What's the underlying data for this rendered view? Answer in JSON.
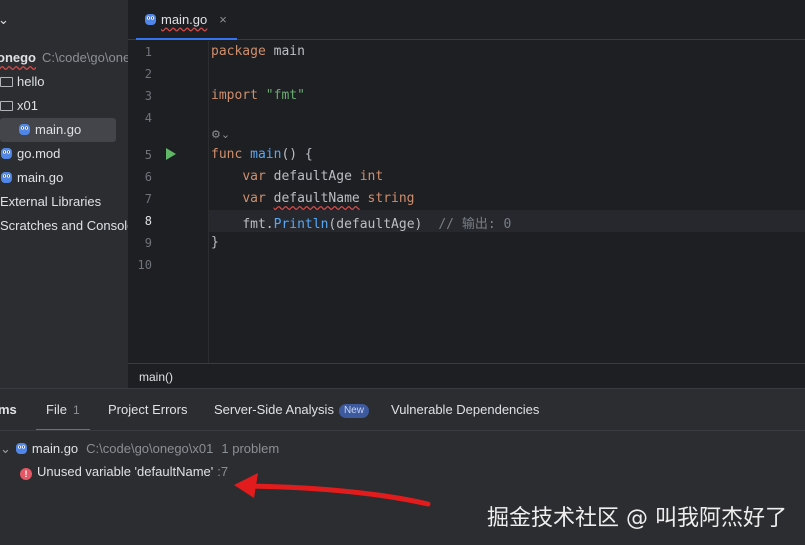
{
  "sidebar": {
    "header_chevron": "⌄",
    "root": {
      "name": "onego",
      "path": "C:\\code\\go\\onego"
    },
    "items": [
      {
        "label": "hello",
        "kind": "folder"
      },
      {
        "label": "x01",
        "kind": "folder"
      },
      {
        "label": "main.go",
        "kind": "go-file",
        "selected": true
      },
      {
        "label": "go.mod",
        "kind": "go-file"
      },
      {
        "label": "main.go",
        "kind": "go-file"
      },
      {
        "label": "External Libraries",
        "kind": "libraries"
      },
      {
        "label": "Scratches and Consoles",
        "kind": "scratches"
      }
    ]
  },
  "editor": {
    "tab": {
      "label": "main.go",
      "close": "×"
    },
    "line_numbers": [
      "1",
      "2",
      "3",
      "4",
      "5",
      "6",
      "7",
      "8",
      "9",
      "10"
    ],
    "current_line": 8,
    "code": {
      "l1_kw": "package",
      "l1_name": "main",
      "l3_kw": "import",
      "l3_str": "\"fmt\"",
      "l5_kw": "func",
      "l5_fn": "main",
      "l5_rest": "() {",
      "l6_kw": "var",
      "l6_name": "defaultAge",
      "l6_type": "int",
      "l7_kw": "var",
      "l7_name": "defaultName",
      "l7_type": "string",
      "l8_pkg": "fmt.",
      "l8_fn": "Println",
      "l8_args": "(defaultAge)",
      "l8_comment": "// 输出: 0",
      "l9": "}"
    },
    "fold_hint": "⚙⌄",
    "breadcrumb": "main()"
  },
  "panel": {
    "title_partial": "ms",
    "tabs": [
      {
        "label": "File",
        "count": "1"
      },
      {
        "label": "Project Errors"
      },
      {
        "label": "Server-Side Analysis",
        "badge": "New"
      },
      {
        "label": "Vulnerable Dependencies"
      }
    ],
    "file_row": {
      "name": "main.go",
      "path": "C:\\code\\go\\onego\\x01",
      "problems": "1 problem"
    },
    "problem": {
      "message": "Unused variable 'defaultName'",
      "line_ref": ":7"
    }
  },
  "watermark": "掘金技术社区 @ 叫我阿杰好了",
  "colors": {
    "accent": "#3574f0",
    "error": "#e55765",
    "arrow": "#e21c1c"
  }
}
